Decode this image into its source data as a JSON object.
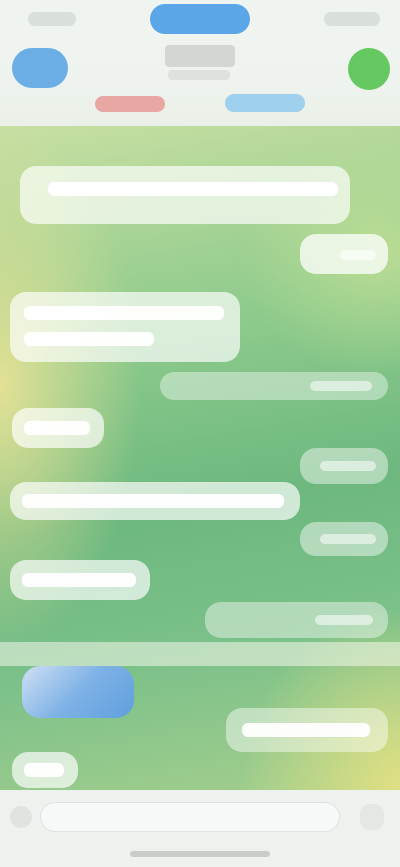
{
  "screen": {
    "note_visible_text": "",
    "colors": {
      "accent_blue": "#5aa6e8",
      "accent_green": "#65c860",
      "chat_bg_green": "#6db87f",
      "chat_bg_yellow": "#e7e296"
    }
  },
  "header": {
    "icons": {
      "back": "back-icon",
      "call": "call-icon"
    },
    "tabs": [
      {
        "icon": "tab-red-icon"
      },
      {
        "icon": "tab-blue-icon"
      }
    ]
  },
  "messages": [
    {
      "side": "in",
      "kind": "text"
    },
    {
      "side": "out",
      "kind": "text"
    },
    {
      "side": "in",
      "kind": "text"
    },
    {
      "side": "out",
      "kind": "text"
    },
    {
      "side": "in",
      "kind": "text"
    },
    {
      "side": "out",
      "kind": "text"
    },
    {
      "side": "in",
      "kind": "text"
    },
    {
      "side": "out",
      "kind": "text"
    },
    {
      "side": "in",
      "kind": "photo"
    },
    {
      "side": "out",
      "kind": "text"
    },
    {
      "side": "in",
      "kind": "text"
    }
  ],
  "composer": {
    "placeholder": "",
    "icons": {
      "attach": "attach-icon",
      "mic": "mic-icon"
    }
  }
}
